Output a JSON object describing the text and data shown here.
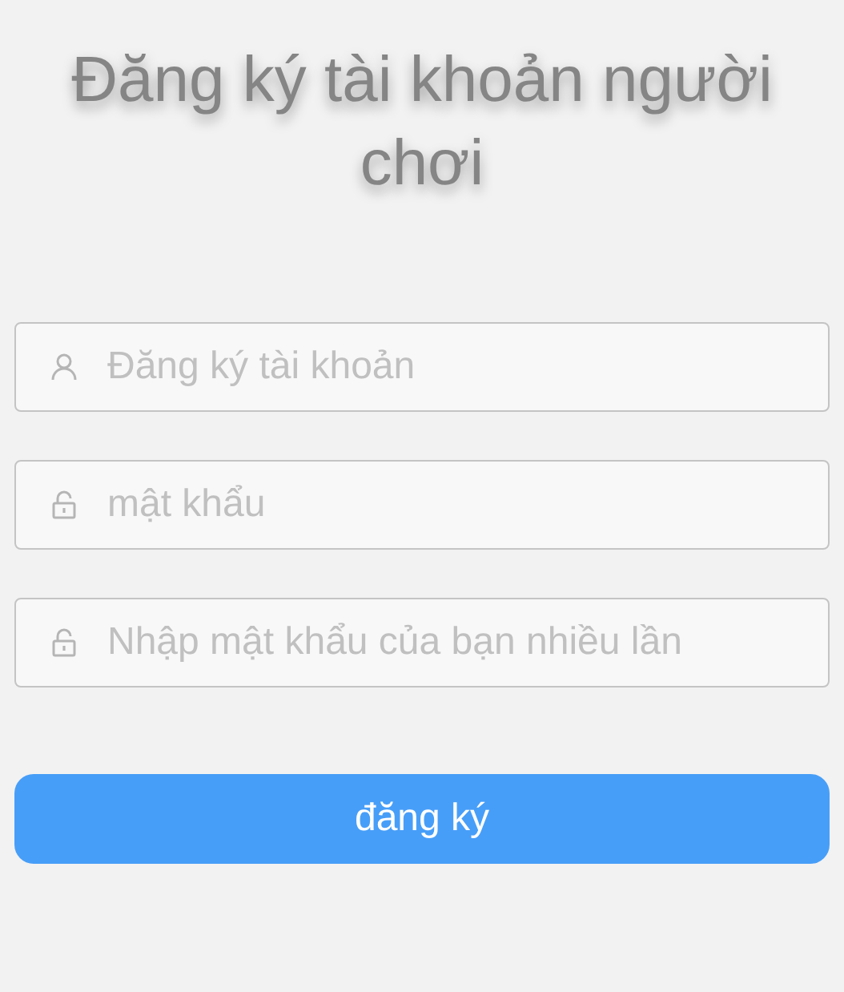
{
  "title": "Đăng ký tài khoản người chơi",
  "fields": [
    {
      "kind": "user",
      "placeholder": "Đăng ký tài khoản"
    },
    {
      "kind": "lock",
      "placeholder": "mật khẩu"
    },
    {
      "kind": "lock",
      "placeholder": "Nhập mật khẩu của bạn nhiều lần"
    }
  ],
  "submit": {
    "label": "đăng ký"
  }
}
